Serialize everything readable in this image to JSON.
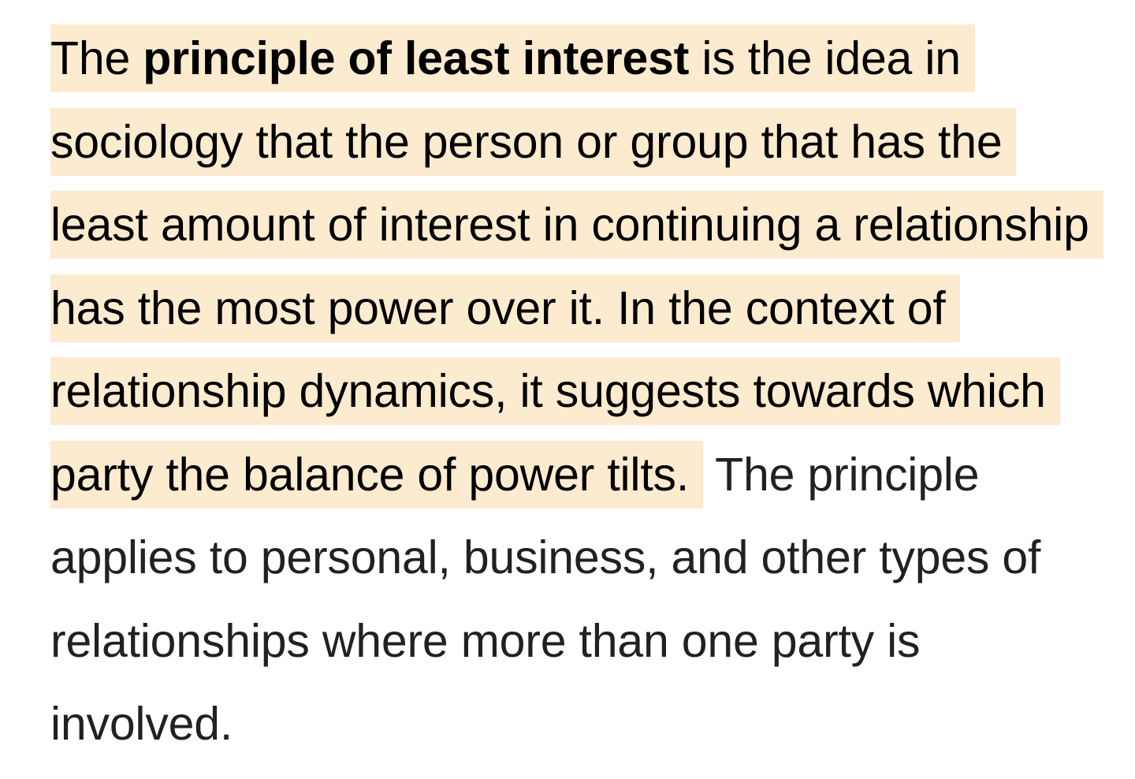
{
  "snippet": {
    "prefix": "The ",
    "term": "principle of least interest",
    "highlight_rest": " is the idea in sociology that the person or group that has the least amount of interest in continuing a relationship has the most power over it. In the context of relationship dynamics, it suggests towards which party the balance of power tilts.",
    "tail": " The principle applies to personal, business, and other types of relationships where more than one party is involved."
  },
  "colors": {
    "highlight_background": "#fdebd0",
    "highlight_text": "#000000",
    "body_text": "#202124",
    "page_background": "#ffffff"
  }
}
